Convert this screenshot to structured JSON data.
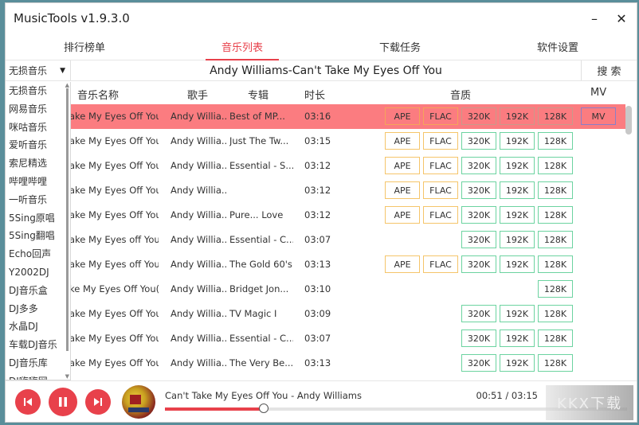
{
  "app": {
    "title": "MusicTools v1.9.3.0"
  },
  "window_controls": {
    "minimize": "–",
    "close": "✕"
  },
  "tabs": [
    {
      "label": "排行榜单",
      "active": false
    },
    {
      "label": "音乐列表",
      "active": true
    },
    {
      "label": "下载任务",
      "active": false
    },
    {
      "label": "软件设置",
      "active": false
    }
  ],
  "search": {
    "source_selected": "无损音乐",
    "query": "Andy Williams-Can't Take My Eyes Off You",
    "button_label": "搜 索"
  },
  "source_dropdown": {
    "options": [
      "无损音乐",
      "网易音乐",
      "咪咕音乐",
      "爱听音乐",
      "索尼精选",
      "哔哩哔哩",
      "一听音乐",
      "5Sing原唱",
      "5Sing翻唱",
      "Echo回声",
      "Y2002DJ",
      "DJ音乐盒",
      "DJ多多",
      "水晶DJ",
      "车载DJ音乐",
      "DJ音乐库",
      "DJ嗨嗨网"
    ]
  },
  "table": {
    "headers": {
      "name": "音乐名称",
      "artist": "歌手",
      "album": "专辑",
      "duration": "时长",
      "quality": "音质",
      "mv": "MV"
    },
    "quality_labels": {
      "ape": "APE",
      "flac": "FLAC",
      "q320": "320K",
      "q192": "192K",
      "q128": "128K",
      "mv": "MV"
    },
    "rows": [
      {
        "name": "ake My Eyes Off You",
        "artist": "Andy Willia...",
        "album": "Best of MP...",
        "duration": "03:16",
        "ape": true,
        "flac": true,
        "q320": true,
        "q192": true,
        "q128": true,
        "mv": true,
        "selected": true
      },
      {
        "name": "ake My Eyes Off You",
        "artist": "Andy Willia...",
        "album": "Just The Tw...",
        "duration": "03:15",
        "ape": true,
        "flac": true,
        "q320": true,
        "q192": true,
        "q128": true,
        "mv": false
      },
      {
        "name": "ake My Eyes Off You",
        "artist": "Andy Willia...",
        "album": "Essential - S...",
        "duration": "03:12",
        "ape": true,
        "flac": true,
        "q320": true,
        "q192": true,
        "q128": true,
        "mv": false
      },
      {
        "name": "ake My Eyes Off You",
        "artist": "Andy Willia...",
        "album": "",
        "duration": "03:12",
        "ape": true,
        "flac": true,
        "q320": true,
        "q192": true,
        "q128": true,
        "mv": false
      },
      {
        "name": "ake My Eyes Off You",
        "artist": "Andy Willia...",
        "album": "Pure... Love",
        "duration": "03:12",
        "ape": true,
        "flac": true,
        "q320": true,
        "q192": true,
        "q128": true,
        "mv": false
      },
      {
        "name": "ake My Eyes off You",
        "artist": "Andy Willia...",
        "album": "Essential - C...",
        "duration": "03:07",
        "ape": false,
        "flac": false,
        "q320": true,
        "q192": true,
        "q128": true,
        "mv": false
      },
      {
        "name": "ake My Eyes off You",
        "artist": "Andy Willia...",
        "album": "The Gold 60's",
        "duration": "03:13",
        "ape": true,
        "flac": true,
        "q320": true,
        "q192": true,
        "q128": true,
        "mv": false
      },
      {
        "name": "ke My Eyes Off You(U...",
        "artist": "Andy Willia...",
        "album": "Bridget Jon...",
        "duration": "03:10",
        "ape": false,
        "flac": false,
        "q320": false,
        "q192": false,
        "q128": true,
        "mv": false
      },
      {
        "name": "ake My Eyes Off You",
        "artist": "Andy Willia...",
        "album": "TV Magic I",
        "duration": "03:09",
        "ape": false,
        "flac": false,
        "q320": true,
        "q192": true,
        "q128": true,
        "mv": false
      },
      {
        "name": "ake My Eyes Off You",
        "artist": "Andy Willia...",
        "album": "Essential - C...",
        "duration": "03:07",
        "ape": false,
        "flac": false,
        "q320": true,
        "q192": true,
        "q128": true,
        "mv": false
      },
      {
        "name": "ake My Eyes Off You",
        "artist": "Andy Willia...",
        "album": "The Very Be...",
        "duration": "03:13",
        "ape": false,
        "flac": false,
        "q320": true,
        "q192": true,
        "q128": true,
        "mv": false
      }
    ]
  },
  "player": {
    "now_playing": "Can't Take My Eyes Off You - Andy Williams",
    "time": "00:51 / 03:15",
    "progress_fraction": 0.213,
    "watermark": "KKX下载"
  },
  "colors": {
    "accent": "#e8414b",
    "selected_row": "#fb7c80",
    "lossless_border": "#f5c56a",
    "mp3_border": "#6cd3a0",
    "mv_border": "#8a7fc8"
  }
}
